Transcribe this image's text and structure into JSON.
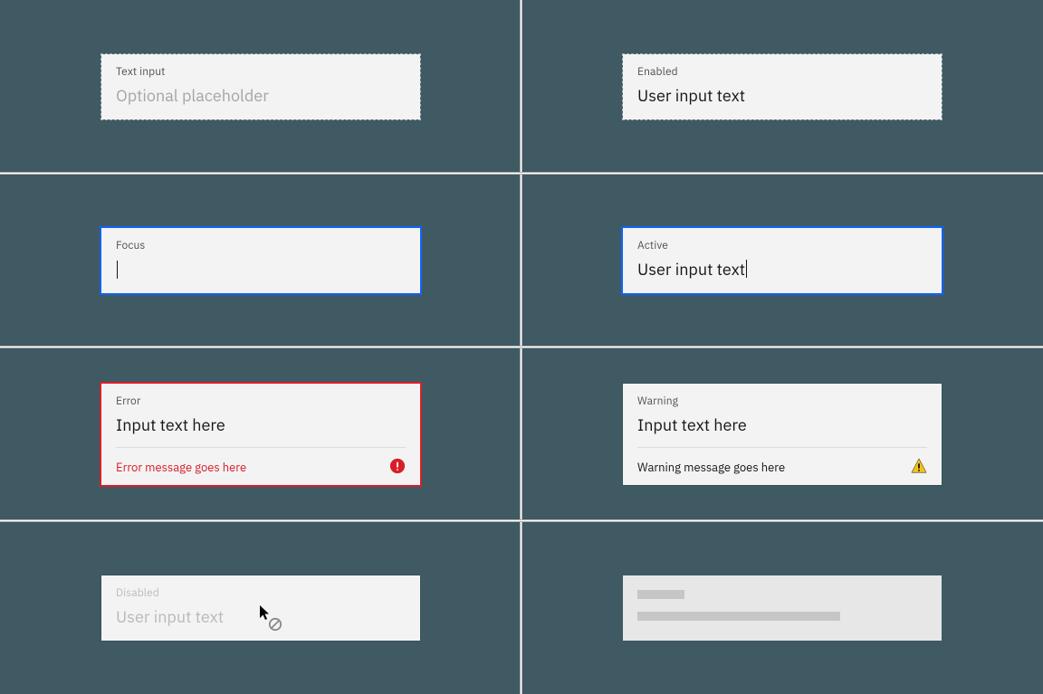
{
  "states": {
    "default": {
      "label": "Text input",
      "placeholder": "Optional placeholder"
    },
    "enabled": {
      "label": "Enabled",
      "value": "User input text"
    },
    "focus": {
      "label": "Focus"
    },
    "active": {
      "label": "Active",
      "value": "User input text"
    },
    "error": {
      "label": "Error",
      "value": "Input text here",
      "message": "Error message goes here"
    },
    "warning": {
      "label": "Warning",
      "value": "Input text here",
      "message": "Warning message goes here"
    },
    "disabled": {
      "label": "Disabled",
      "value": "User input text"
    },
    "skeleton": {}
  },
  "colors": {
    "focus": "#0f62fe",
    "error": "#da1e28",
    "warning": "#f1c21b",
    "background": "#3f5a63"
  }
}
